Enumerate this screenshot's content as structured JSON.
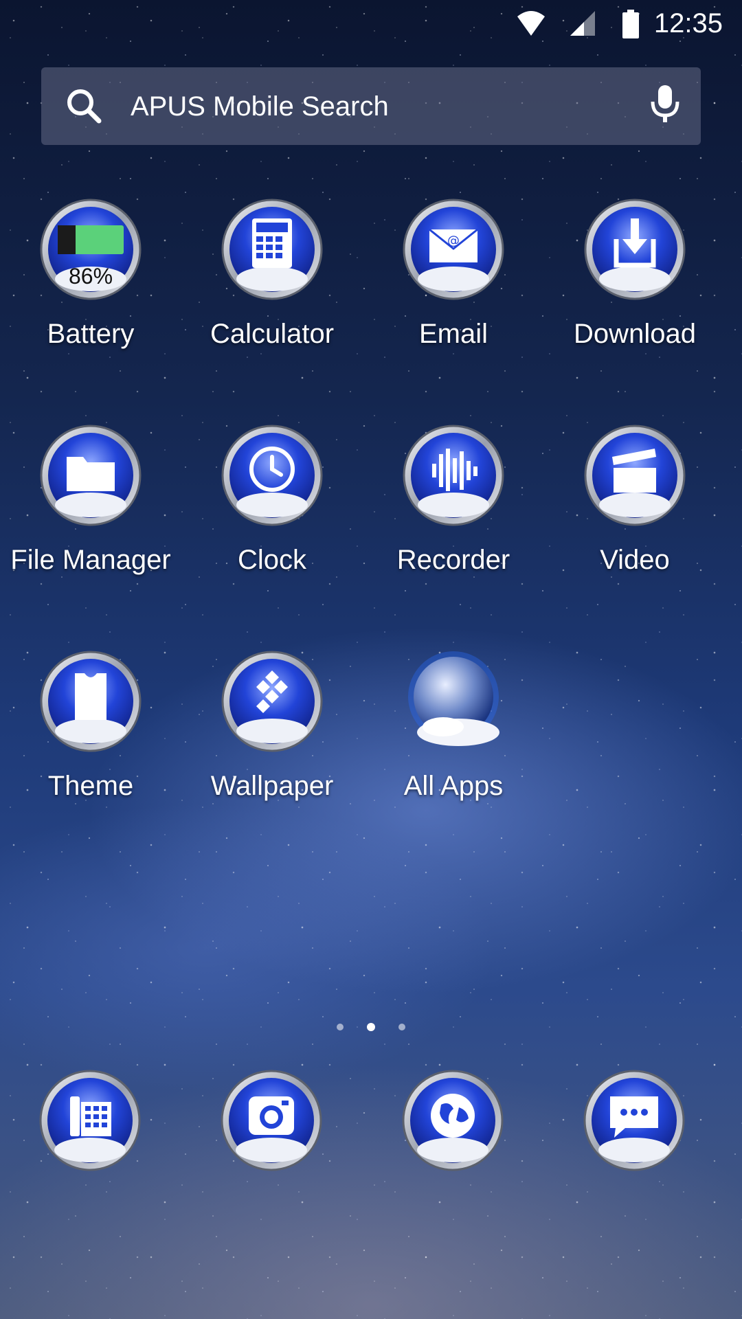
{
  "status_bar": {
    "time": "12:35",
    "icons": [
      "wifi-icon",
      "cell-signal-icon",
      "battery-icon"
    ]
  },
  "search": {
    "placeholder": "APUS Mobile Search",
    "icon": "search-icon",
    "voice_icon": "microphone-icon"
  },
  "apps": [
    {
      "label": "Battery",
      "icon": "battery-icon",
      "badge": "86%"
    },
    {
      "label": "Calculator",
      "icon": "calculator-icon"
    },
    {
      "label": "Email",
      "icon": "email-icon"
    },
    {
      "label": "Download",
      "icon": "download-icon"
    },
    {
      "label": "File Manager",
      "icon": "folder-icon"
    },
    {
      "label": "Clock",
      "icon": "clock-icon"
    },
    {
      "label": "Recorder",
      "icon": "soundwave-icon"
    },
    {
      "label": "Video",
      "icon": "clapperboard-icon"
    },
    {
      "label": "Theme",
      "icon": "shirt-icon"
    },
    {
      "label": "Wallpaper",
      "icon": "diamond-grid-icon"
    },
    {
      "label": "All Apps",
      "icon": "planet-icon"
    }
  ],
  "pager": {
    "pages": 3,
    "current": 2
  },
  "dock": [
    {
      "icon": "phone-icon"
    },
    {
      "icon": "camera-icon"
    },
    {
      "icon": "globe-icon"
    },
    {
      "icon": "message-icon"
    }
  ],
  "colors": {
    "icon_inner": "#1a3bd1",
    "icon_ring": "#c9ccd6",
    "battery_fill": "#5bd17a"
  }
}
